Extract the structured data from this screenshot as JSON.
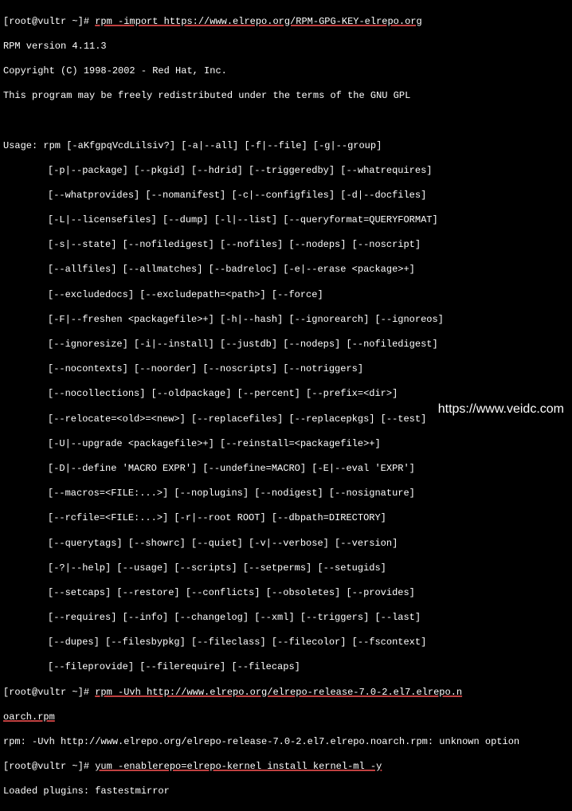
{
  "prompt1": "[root@vultr ~]# ",
  "cmd1": "rpm -import https://www.elrepo.org/RPM-GPG-KEY-elrepo.org",
  "version_line": "RPM version 4.11.3",
  "copyright": "Copyright (C) 1998-2002 - Red Hat, Inc.",
  "redistrib": "This program may be freely redistributed under the terms of the GNU GPL",
  "usage_head": "Usage: rpm [-aKfgpqVcdLilsiv?] [-a|--all] [-f|--file] [-g|--group]",
  "usage_lines": [
    "[-p|--package] [--pkgid] [--hdrid] [--triggeredby] [--whatrequires]",
    "[--whatprovides] [--nomanifest] [-c|--configfiles] [-d|--docfiles]",
    "[-L|--licensefiles] [--dump] [-l|--list] [--queryformat=QUERYFORMAT]",
    "[-s|--state] [--nofiledigest] [--nofiles] [--nodeps] [--noscript]",
    "[--allfiles] [--allmatches] [--badreloc] [-e|--erase <package>+]",
    "[--excludedocs] [--excludepath=<path>] [--force]",
    "[-F|--freshen <packagefile>+] [-h|--hash] [--ignorearch] [--ignoreos]",
    "[--ignoresize] [-i|--install] [--justdb] [--nodeps] [--nofiledigest]",
    "[--nocontexts] [--noorder] [--noscripts] [--notriggers]",
    "[--nocollections] [--oldpackage] [--percent] [--prefix=<dir>]",
    "[--relocate=<old>=<new>] [--replacefiles] [--replacepkgs] [--test]",
    "[-U|--upgrade <packagefile>+] [--reinstall=<packagefile>+]",
    "[-D|--define 'MACRO EXPR'] [--undefine=MACRO] [-E|--eval 'EXPR']",
    "[--macros=<FILE:...>] [--noplugins] [--nodigest] [--nosignature]",
    "[--rcfile=<FILE:...>] [-r|--root ROOT] [--dbpath=DIRECTORY]",
    "[--querytags] [--showrc] [--quiet] [-v|--verbose] [--version]",
    "[-?|--help] [--usage] [--scripts] [--setperms] [--setugids]",
    "[--setcaps] [--restore] [--conflicts] [--obsoletes] [--provides]",
    "[--requires] [--info] [--changelog] [--xml] [--triggers] [--last]",
    "[--dupes] [--filesbypkg] [--fileclass] [--filecolor] [--fscontext]",
    "[--fileprovide] [--filerequire] [--filecaps]"
  ],
  "prompt2": "[root@vultr ~]# ",
  "cmd2a": "rpm -Uvh http://www.elrepo.org/elrepo-release-7.0-2.el7.elrepo.n",
  "cmd2b": "oarch.rpm",
  "error_line": "rpm: -Uvh http://www.elrepo.org/elrepo-release-7.0-2.el7.elrepo.noarch.rpm: unknown option",
  "prompt3": "[root@vultr ~]# ",
  "cmd3": "yum -enablerepo=elrepo-kernel install kernel-ml -y",
  "plugins_line": "Loaded plugins: fastestmirror",
  "watermark": "https://www.veidc.com"
}
